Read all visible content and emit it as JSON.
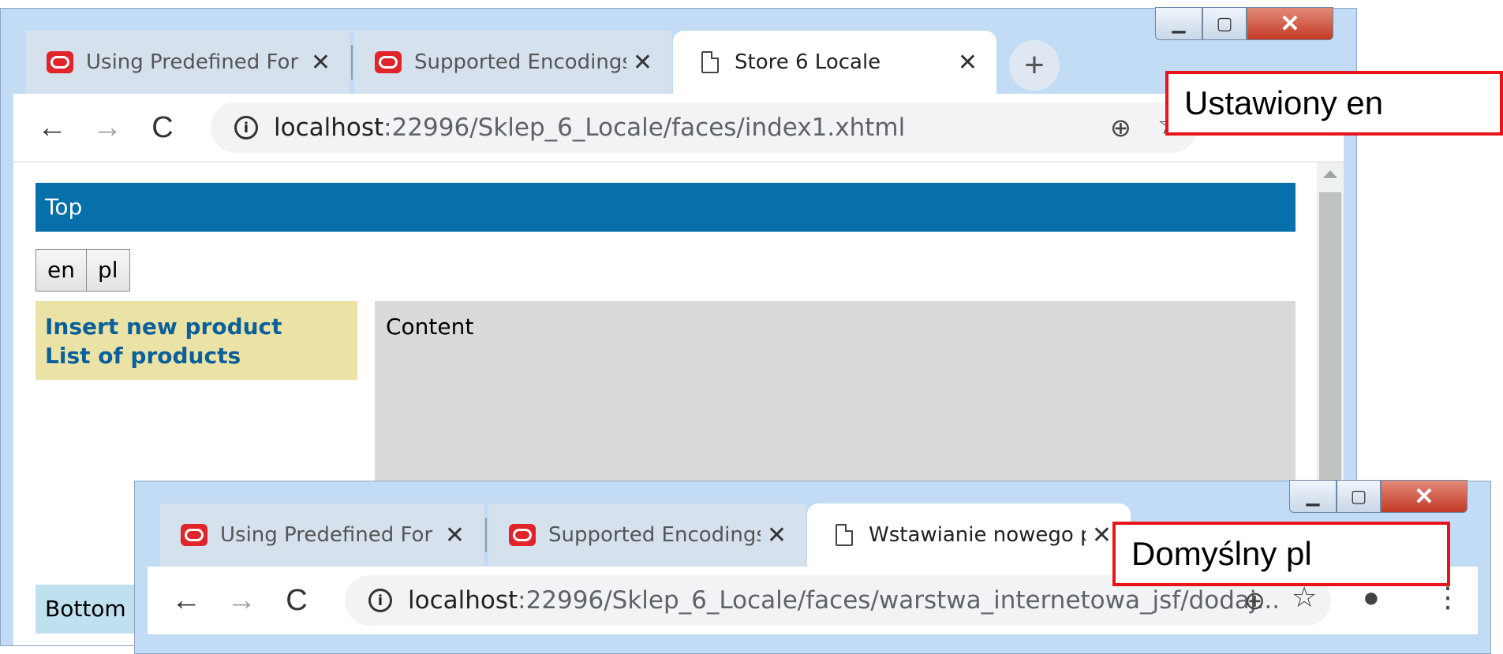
{
  "window1": {
    "tabs": [
      {
        "title": "Using Predefined For",
        "icon": "oracle-icon"
      },
      {
        "title": "Supported Encodings",
        "icon": "oracle-icon"
      },
      {
        "title": "Store 6 Locale",
        "icon": "document-icon"
      }
    ],
    "tab_close": "✕",
    "new_tab": "+",
    "url": {
      "host": "localhost",
      "path": ":22996/Sklep_6_Locale/faces/index1.xhtml"
    },
    "page": {
      "top": "Top",
      "lang_buttons": [
        "en",
        "pl"
      ],
      "menu": [
        "Insert new product",
        "List of products"
      ],
      "content": "Content",
      "bottom": "Bottom"
    }
  },
  "window2": {
    "tabs": [
      {
        "title": "Using Predefined For",
        "icon": "oracle-icon"
      },
      {
        "title": "Supported Encodings",
        "icon": "oracle-icon"
      },
      {
        "title": "Wstawianie nowego p",
        "icon": "document-icon"
      }
    ],
    "tab_close": "✕",
    "url": {
      "host": "localhost",
      "path": ":22996/Sklep_6_Locale/faces/warstwa_internetowa_jsf/dodaj..."
    }
  },
  "callouts": {
    "first": "Ustawiony en",
    "second": "Domyślny pl"
  },
  "icons": {
    "back": "←",
    "forward": "→",
    "reload": "C",
    "zoom": "⊕",
    "star": "☆",
    "account": "●",
    "menu": "⋮"
  },
  "colors": {
    "topbar": "#0770aa",
    "menu_bg": "#ebe3a6",
    "menu_link": "#0b5f9a",
    "bottom_bg": "#bfe0ef",
    "callout_border": "#e8141c"
  }
}
